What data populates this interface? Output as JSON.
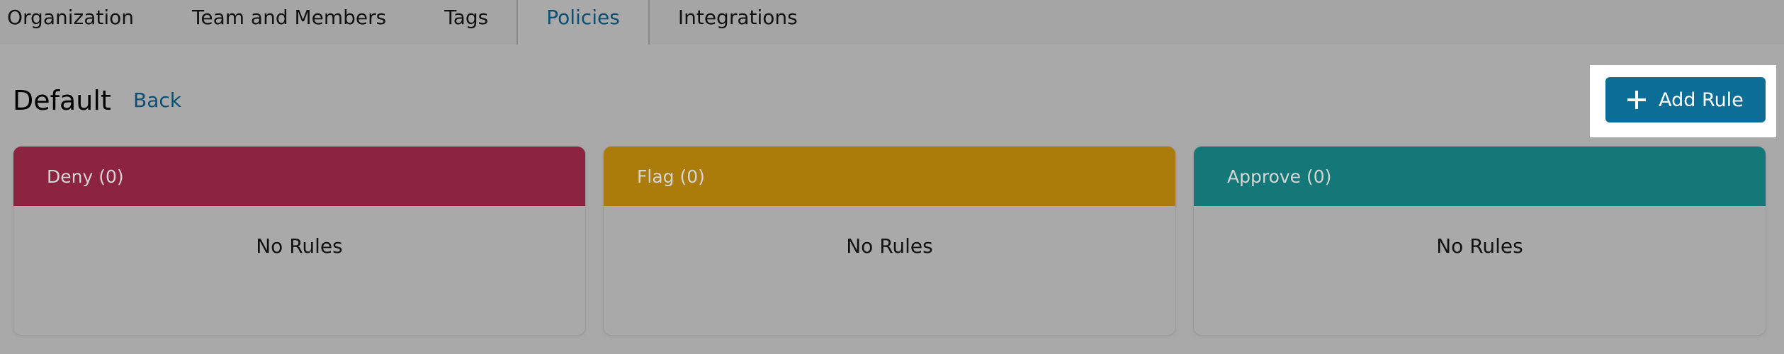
{
  "tabs": [
    {
      "label": "Organization",
      "active": false
    },
    {
      "label": "Team and Members",
      "active": false
    },
    {
      "label": "Tags",
      "active": false
    },
    {
      "label": "Policies",
      "active": true
    },
    {
      "label": "Integrations",
      "active": false
    }
  ],
  "header": {
    "title": "Default",
    "back_label": "Back",
    "add_rule_label": "Add Rule",
    "add_rule_icon": "plus-icon"
  },
  "cards": [
    {
      "title": "Deny (0)",
      "empty_text": "No Rules",
      "color": "#8b2341"
    },
    {
      "title": "Flag (0)",
      "empty_text": "No Rules",
      "color": "#ab7c0b"
    },
    {
      "title": "Approve (0)",
      "empty_text": "No Rules",
      "color": "#137877"
    }
  ],
  "colors": {
    "accent": "#0c6e96",
    "active_tab_text": "#0b4f74",
    "background": "#a9a9a9"
  }
}
